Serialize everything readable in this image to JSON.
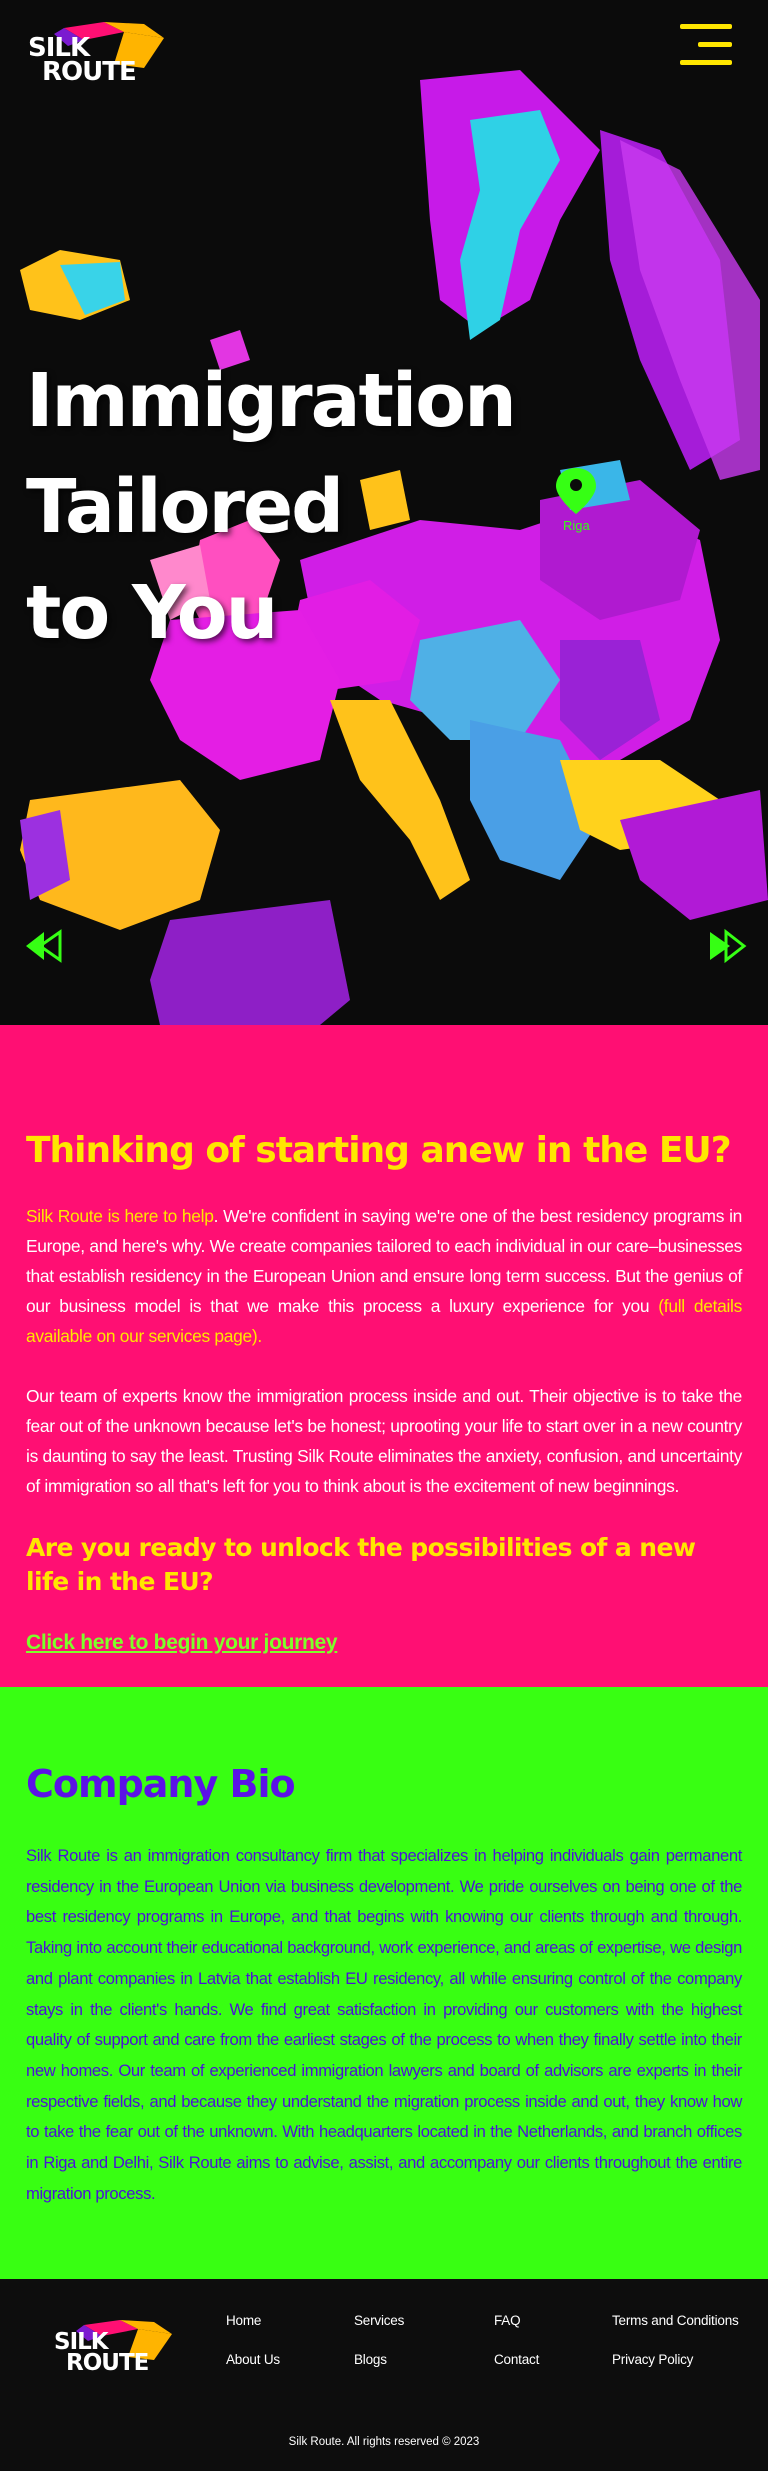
{
  "header": {
    "logo_line1": "SILK",
    "logo_line2": "ROUTE"
  },
  "hero": {
    "title_line1": "Immigration",
    "title_line2": "Tailored",
    "title_line3": "to You",
    "map_pin_label": "Riga"
  },
  "intro": {
    "heading": "Thinking of starting anew in the EU?",
    "p1_highlight": "Silk Route is here to help",
    "p1_text": ". We're confident in saying we're one of the best residency programs in Europe, and here's why. We create companies tailored to each individual in our care–businesses that establish residency in the European Union and ensure long term success. But the genius of our business model is that we make this process a luxury experience for you ",
    "p1_link": "(full details available on our services page).",
    "p2_text": "Our team of experts know the immigration process inside and out. Their objective is to take the fear out of the unknown because let's be honest; uprooting your life to start over in a new country is daunting to say the least. Trusting Silk Route eliminates the anxiety, confusion, and uncertainty of immigration so all that's left for you to think about is the excitement of new beginnings.",
    "subheading": "Are you ready to unlock the possibilities of a new life in the EU?",
    "cta": "Click here to begin your journey"
  },
  "bio": {
    "heading": "Company Bio",
    "text": "Silk Route is an immigration consultancy firm that specializes in helping individuals gain permanent residency in the European Union via business development. We pride ourselves on being one of the best residency programs in Europe, and that begins with knowing our clients through and through. Taking into account their educational background, work experience, and areas of expertise, we design and plant companies in Latvia that establish EU residency, all while ensuring control of the company stays in the client's hands. We find great satisfaction in providing our customers with the highest quality of support and care from the earliest stages of the process to when they finally settle into their new homes. Our team of experienced immigration lawyers and board of advisors are experts in their respective fields, and because they understand the migration process inside and out, they know how to take the fear out of the unknown. With headquarters located in the Netherlands, and branch offices in Riga and Delhi, Silk Route aims to advise, assist, and accompany our clients throughout the entire migration process."
  },
  "footer": {
    "links": {
      "home": "Home",
      "about": "About Us",
      "services": "Services",
      "blogs": "Blogs",
      "faq": "FAQ",
      "contact": "Contact",
      "terms": "Terms and Conditions",
      "privacy": "Privacy Policy"
    },
    "copyright": "Silk Route. All rights reserved © 2023"
  },
  "colors": {
    "pink": "#ff0f73",
    "yellow": "#ffe600",
    "green": "#38ff12",
    "violet": "#5b12e6",
    "dark": "#0d0d0d"
  },
  "icons": [
    "menu-icon",
    "prev-arrow-icon",
    "next-arrow-icon",
    "map-pin-icon"
  ]
}
